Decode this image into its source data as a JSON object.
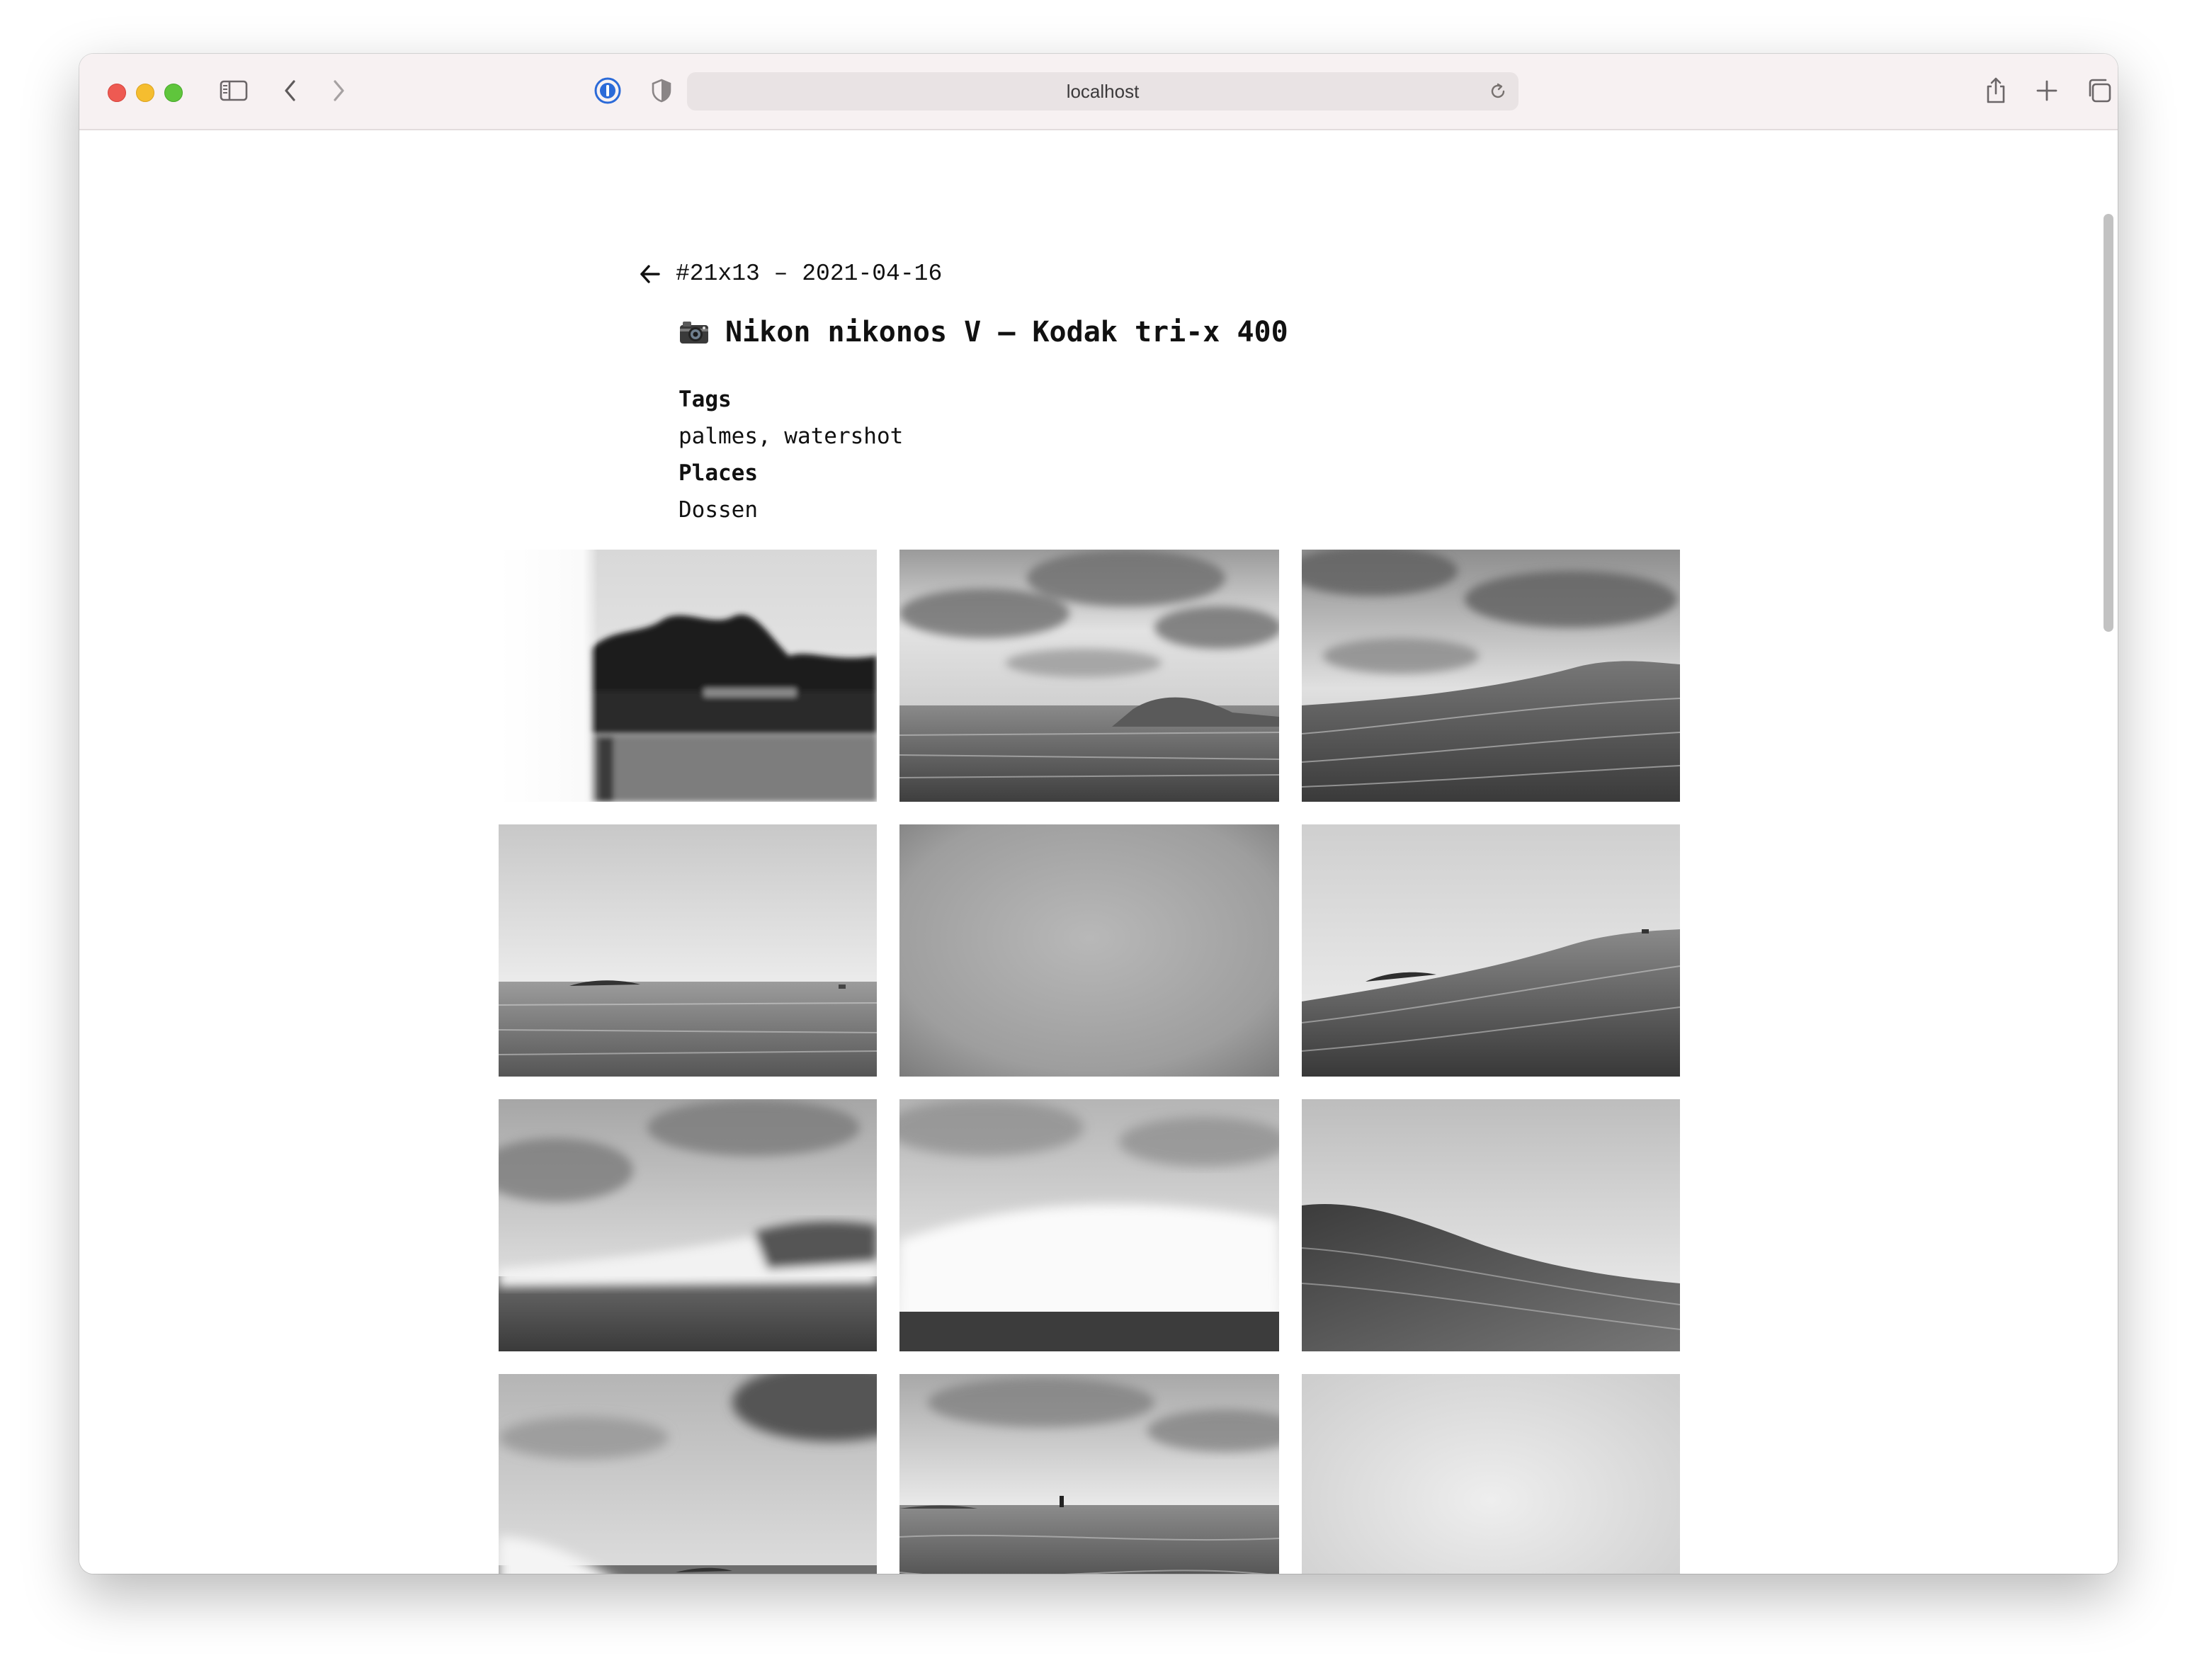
{
  "browser": {
    "address": "localhost"
  },
  "page": {
    "roll_line": "#21x13 – 2021-04-16",
    "title": "Nikon nikonos V – Kodak tri-x 400",
    "tags_label": "Tags",
    "tags_value": "palmes, watershot",
    "places_label": "Places",
    "places_value": "Dossen"
  },
  "photos": [
    {
      "subject": "blurred hedge with white light leak"
    },
    {
      "subject": "cloudy sky over breaking wave"
    },
    {
      "subject": "cloudy sky over rising wave"
    },
    {
      "subject": "overcast sea with distant rocks"
    },
    {
      "subject": "grey fogged frame"
    },
    {
      "subject": "tilted wave with distant rocks"
    },
    {
      "subject": "clouds over breaking wave crest"
    },
    {
      "subject": "white foam of breaking wave"
    },
    {
      "subject": "dark wave slope under bright sky"
    },
    {
      "subject": "dark cloud over wave splash"
    },
    {
      "subject": "calm sea with distant buoy"
    },
    {
      "subject": "pale overexposed sky"
    }
  ]
}
